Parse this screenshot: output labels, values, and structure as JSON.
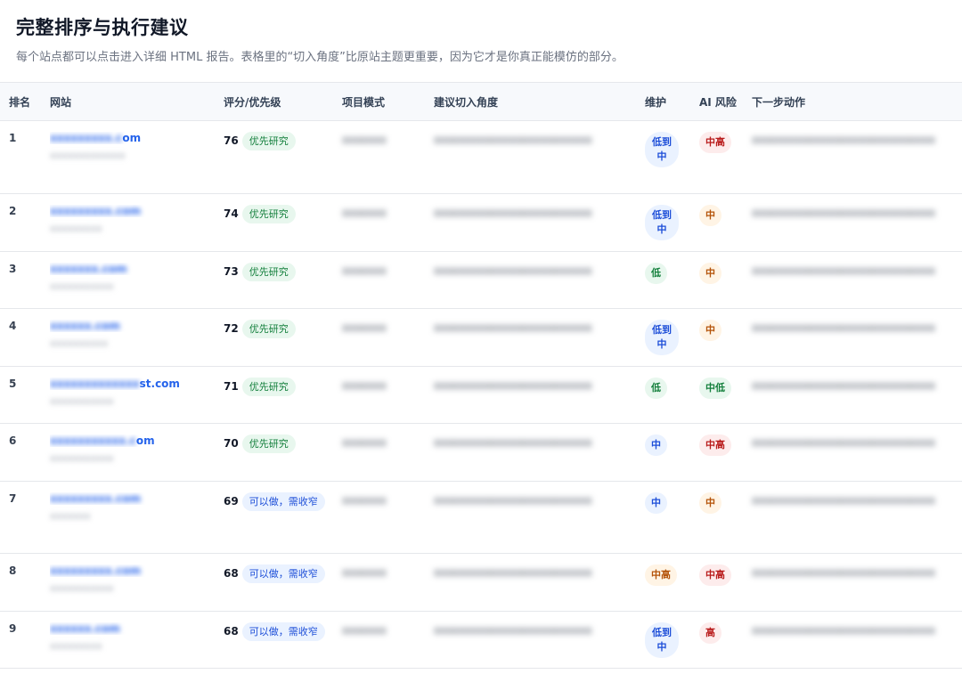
{
  "page": {
    "title": "完整排序与执行建议",
    "subtitle": "每个站点都可以点击进入详细 HTML 报告。表格里的“切入角度”比原站主题更重要，因为它才是你真正能模仿的部分。"
  },
  "table": {
    "headers": [
      "排名",
      "网站",
      "评分/优先级",
      "项目模式",
      "建议切入角度",
      "维护",
      "AI 风险",
      "下一步动作"
    ],
    "rows": [
      {
        "rank": "1",
        "site_visible": "om",
        "site_hidden": "xxxxxxxxx.c",
        "site_sub": "xxxxxxxxxxxxx",
        "score": "76",
        "priority": "优先研究",
        "mode": "xxxxxxx",
        "angle": "xxxxxxxxxxxxxxxxxxxxxxxxx",
        "maint": "低到中",
        "ai": "中高",
        "next": "xxxxxxxxxxxxxxxxxxxxxxxxxxxxx"
      },
      {
        "rank": "2",
        "site_visible": "",
        "site_hidden": "xxxxxxxxx.com",
        "site_sub": "xxxxxxxxx",
        "score": "74",
        "priority": "优先研究",
        "mode": "xxxxxxx",
        "angle": "xxxxxxxxxxxxxxxxxxxxxxxxx",
        "maint": "低到中",
        "ai": "中",
        "next": "xxxxxxxxxxxxxxxxxxxxxxxxxxxxx"
      },
      {
        "rank": "3",
        "site_visible": "",
        "site_hidden": "xxxxxxx.com",
        "site_sub": "xxxxxxxxxxx",
        "score": "73",
        "priority": "优先研究",
        "mode": "xxxxxxx",
        "angle": "xxxxxxxxxxxxxxxxxxxxxxxxx",
        "maint": "低",
        "ai": "中",
        "next": "xxxxxxxxxxxxxxxxxxxxxxxxxxxxx"
      },
      {
        "rank": "4",
        "site_visible": "",
        "site_hidden": "xxxxxx.com",
        "site_sub": "xxxxxxxxxx",
        "score": "72",
        "priority": "优先研究",
        "mode": "xxxxxxx",
        "angle": "xxxxxxxxxxxxxxxxxxxxxxxxx",
        "maint": "低到中",
        "ai": "中",
        "next": "xxxxxxxxxxxxxxxxxxxxxxxxxxxxx"
      },
      {
        "rank": "5",
        "site_visible": "st.com",
        "site_hidden": "xxxxxxxxxxxxx",
        "site_sub": "xxxxxxxxxxx",
        "score": "71",
        "priority": "优先研究",
        "mode": "xxxxxxx",
        "angle": "xxxxxxxxxxxxxxxxxxxxxxxxx",
        "maint": "低",
        "ai": "中低",
        "next": "xxxxxxxxxxxxxxxxxxxxxxxxxxxxx"
      },
      {
        "rank": "6",
        "site_visible": "om",
        "site_hidden": "xxxxxxxxxxx.c",
        "site_sub": "xxxxxxxxxxx",
        "score": "70",
        "priority": "优先研究",
        "mode": "xxxxxxx",
        "angle": "xxxxxxxxxxxxxxxxxxxxxxxxx",
        "maint": "中",
        "ai": "中高",
        "next": "xxxxxxxxxxxxxxxxxxxxxxxxxxxxx"
      },
      {
        "rank": "7",
        "site_visible": "",
        "site_hidden": "xxxxxxxxx.com",
        "site_sub": "xxxxxxx",
        "score": "69",
        "priority": "可以做，需收窄",
        "mode": "xxxxxxx",
        "angle": "xxxxxxxxxxxxxxxxxxxxxxxxx",
        "maint": "中",
        "ai": "中",
        "next": "xxxxxxxxxxxxxxxxxxxxxxxxxxxxx"
      },
      {
        "rank": "8",
        "site_visible": "",
        "site_hidden": "xxxxxxxxx.com",
        "site_sub": "xxxxxxxxxxx",
        "score": "68",
        "priority": "可以做，需收窄",
        "mode": "xxxxxxx",
        "angle": "xxxxxxxxxxxxxxxxxxxxxxxxx",
        "maint": "中高",
        "ai": "中高",
        "next": "xxxxxxxxxxxxxxxxxxxxxxxxxxxxx"
      },
      {
        "rank": "9",
        "site_visible": "",
        "site_hidden": "xxxxxx.com",
        "site_sub": "xxxxxxxxx",
        "score": "68",
        "priority": "可以做，需收窄",
        "mode": "xxxxxxx",
        "angle": "xxxxxxxxxxxxxxxxxxxxxxxxx",
        "maint": "低到中",
        "ai": "高",
        "next": "xxxxxxxxxxxxxxxxxxxxxxxxxxxxx"
      }
    ]
  }
}
